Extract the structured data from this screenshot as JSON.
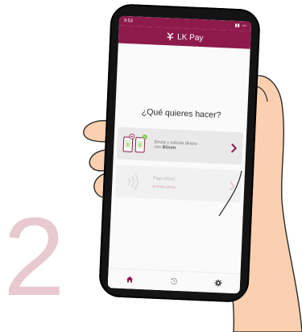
{
  "step_number": "2",
  "status_bar": {
    "time": "9:53"
  },
  "app": {
    "title": "LK Pay"
  },
  "main": {
    "question": "¿Qué quieres hacer?",
    "options": [
      {
        "label_line1": "Envía y solicita dinero",
        "label_prefix": "con ",
        "label_bold": "Bizum",
        "subtext": ""
      },
      {
        "label_line1": "Pago Móvil",
        "label_prefix": "",
        "label_bold": "",
        "subtext": "Activalo ahora"
      }
    ]
  },
  "bottom_nav": [
    {
      "icon": "home-icon"
    },
    {
      "icon": "history-icon"
    },
    {
      "icon": "settings-icon"
    }
  ],
  "colors": {
    "brand": "#8e1a4c",
    "accent_green": "#7ac142",
    "step_number": "#e7c9cf",
    "chevron": "#8e1a4c"
  }
}
